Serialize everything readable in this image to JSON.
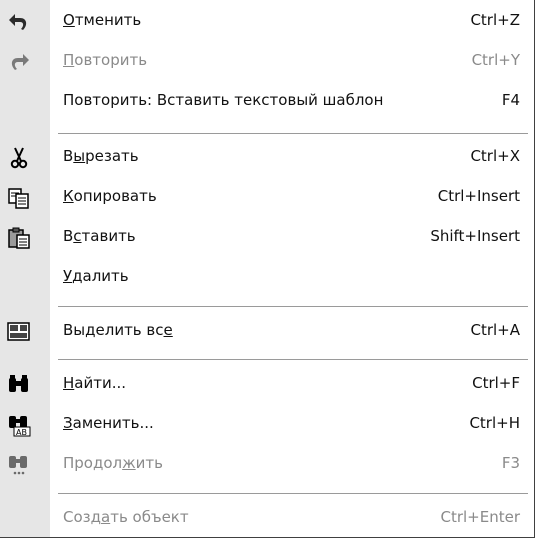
{
  "menu": {
    "items": [
      {
        "pre": "",
        "ul": "О",
        "post": "тменить",
        "shortcut": "Ctrl+Z",
        "icon": "undo-icon",
        "disabled": false
      },
      {
        "pre": "",
        "ul": "П",
        "post": "овторить",
        "shortcut": "Ctrl+Y",
        "icon": "redo-icon",
        "disabled": true
      },
      {
        "pre": "Повторить: Вставить текстовый шаблон",
        "ul": "",
        "post": "",
        "shortcut": "F4",
        "icon": "",
        "disabled": false
      },
      {
        "pre": "В",
        "ul": "ы",
        "post": "резать",
        "shortcut": "Ctrl+X",
        "icon": "scissors-icon",
        "disabled": false
      },
      {
        "pre": "",
        "ul": "К",
        "post": "опировать",
        "shortcut": "Ctrl+Insert",
        "icon": "copy-icon",
        "disabled": false
      },
      {
        "pre": "В",
        "ul": "с",
        "post": "тавить",
        "shortcut": "Shift+Insert",
        "icon": "paste-icon",
        "disabled": false
      },
      {
        "pre": "",
        "ul": "У",
        "post": "далить",
        "shortcut": "",
        "icon": "",
        "disabled": false
      },
      {
        "pre": "Выделить вс",
        "ul": "е",
        "post": "",
        "shortcut": "Ctrl+A",
        "icon": "select-all-icon",
        "disabled": false
      },
      {
        "pre": "",
        "ul": "Н",
        "post": "айти...",
        "shortcut": "Ctrl+F",
        "icon": "binoculars-icon",
        "disabled": false
      },
      {
        "pre": "",
        "ul": "З",
        "post": "аменить...",
        "shortcut": "Ctrl+H",
        "icon": "replace-icon",
        "disabled": false
      },
      {
        "pre": "Продол",
        "ul": "ж",
        "post": "ить",
        "shortcut": "F3",
        "icon": "find-next-icon",
        "disabled": true
      },
      {
        "pre": "Созд",
        "ul": "а",
        "post": "ть объект",
        "shortcut": "Ctrl+Enter",
        "icon": "",
        "disabled": true
      }
    ]
  }
}
